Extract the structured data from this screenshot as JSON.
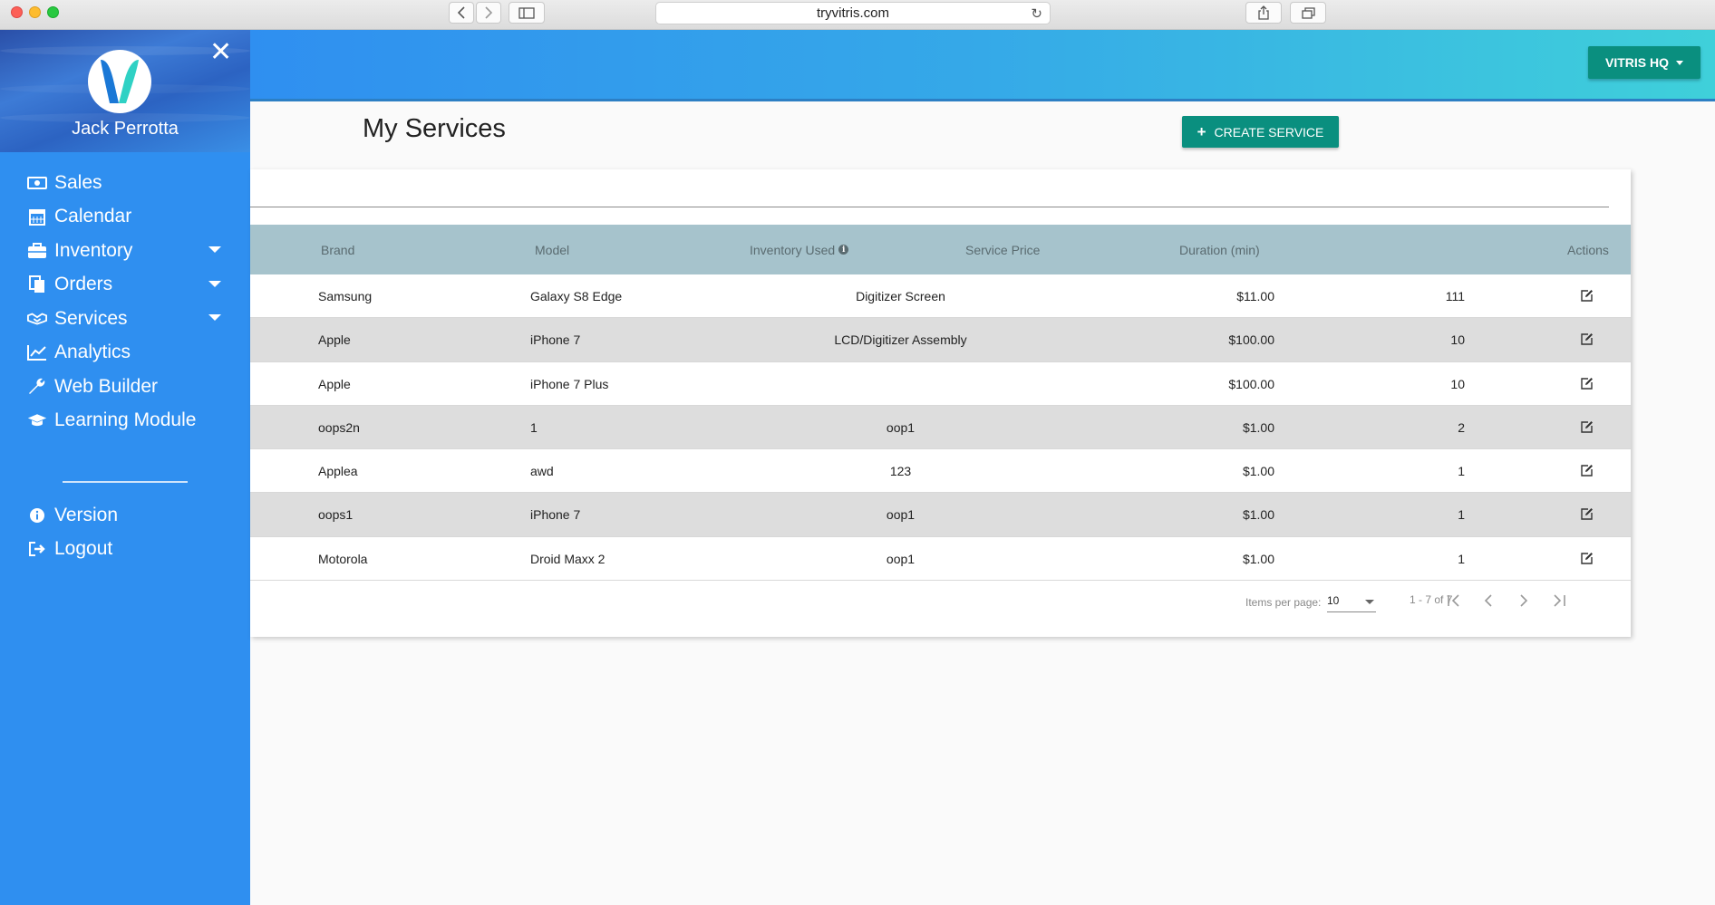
{
  "browser": {
    "url": "tryvitris.com"
  },
  "sidebar": {
    "user_name": "Jack Perrotta",
    "items": [
      {
        "label": "Sales",
        "icon": "money-icon",
        "expandable": false
      },
      {
        "label": "Calendar",
        "icon": "calendar-icon",
        "expandable": false
      },
      {
        "label": "Inventory",
        "icon": "briefcase-icon",
        "expandable": true
      },
      {
        "label": "Orders",
        "icon": "copy-icon",
        "expandable": true
      },
      {
        "label": "Services",
        "icon": "handshake-icon",
        "expandable": true
      },
      {
        "label": "Analytics",
        "icon": "line-chart-icon",
        "expandable": false
      },
      {
        "label": "Web Builder",
        "icon": "wrench-icon",
        "expandable": false
      },
      {
        "label": "Learning Module",
        "icon": "graduation-cap-icon",
        "expandable": false
      }
    ],
    "secondary_items": [
      {
        "label": "Version",
        "icon": "info-circle-icon"
      },
      {
        "label": "Logout",
        "icon": "sign-out-icon"
      }
    ]
  },
  "header": {
    "store_button": "VITRIS HQ"
  },
  "main": {
    "title": "My Services",
    "create_button": "CREATE SERVICE"
  },
  "table": {
    "columns": [
      "Brand",
      "Model",
      "Inventory Used",
      "Service Price",
      "Duration (min)",
      "Actions"
    ],
    "rows": [
      {
        "brand": "Samsung",
        "model": "Galaxy S8 Edge",
        "inventory": "Digitizer Screen",
        "price": "$11.00",
        "duration": "111"
      },
      {
        "brand": "Apple",
        "model": "iPhone 7",
        "inventory": "LCD/Digitizer Assembly",
        "price": "$100.00",
        "duration": "10"
      },
      {
        "brand": "Apple",
        "model": "iPhone 7 Plus",
        "inventory": "",
        "price": "$100.00",
        "duration": "10"
      },
      {
        "brand": "oops2n",
        "model": "1",
        "inventory": "oop1",
        "price": "$1.00",
        "duration": "2"
      },
      {
        "brand": "Applea",
        "model": "awd",
        "inventory": "123",
        "price": "$1.00",
        "duration": "1"
      },
      {
        "brand": "oops1",
        "model": "iPhone 7",
        "inventory": "oop1",
        "price": "$1.00",
        "duration": "1"
      },
      {
        "brand": "Motorola",
        "model": "Droid Maxx 2",
        "inventory": "oop1",
        "price": "$1.00",
        "duration": "1"
      }
    ]
  },
  "pagination": {
    "items_per_page_label": "Items per page:",
    "items_per_page": "10",
    "range": "1 - 7 of 7"
  },
  "colors": {
    "sidebar": "#2f8ff0",
    "accent_button": "#0a8f7f",
    "table_header": "#a6c3cc",
    "row_alt": "#dddddd"
  }
}
